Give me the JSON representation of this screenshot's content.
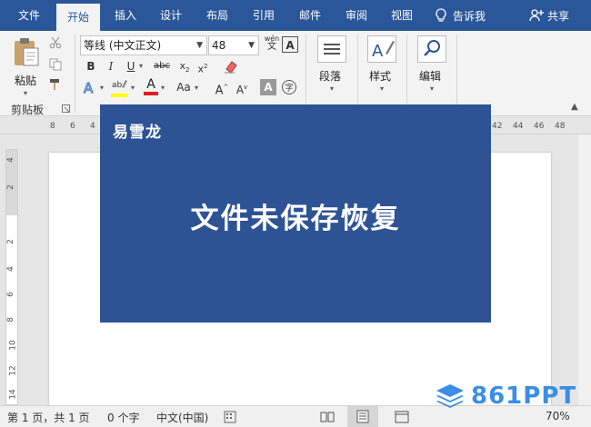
{
  "tabs": [
    {
      "label": "文件",
      "active": false
    },
    {
      "label": "开始",
      "active": true
    },
    {
      "label": "插入",
      "active": false
    },
    {
      "label": "设计",
      "active": false
    },
    {
      "label": "布局",
      "active": false
    },
    {
      "label": "引用",
      "active": false
    },
    {
      "label": "邮件",
      "active": false
    },
    {
      "label": "审阅",
      "active": false
    },
    {
      "label": "视图",
      "active": false
    }
  ],
  "tell_me": "告诉我",
  "share": "共享",
  "clipboard": {
    "paste_label": "粘贴",
    "group_label": "剪贴板"
  },
  "font": {
    "name": "等线 (中文正文)",
    "size": "48",
    "phonetic_glyph": "wén"
  },
  "paragraph": {
    "label": "段落"
  },
  "styles": {
    "label": "样式"
  },
  "editing": {
    "label": "编辑"
  },
  "ruler": {
    "h_left": [
      "8",
      "6",
      "4"
    ],
    "h_right": [
      "42",
      "44",
      "46",
      "48"
    ],
    "v": [
      "4",
      "2",
      "2",
      "4",
      "6",
      "8",
      "10",
      "12",
      "14"
    ]
  },
  "banner": {
    "brand": "易雪龙",
    "headline": "文件未保存恢复"
  },
  "status": {
    "page": "第 1 页，共 1 页",
    "words": "0 个字",
    "language": "中文(中国)",
    "zoom": "70%"
  },
  "watermark": "861PPT",
  "colors": {
    "brand_blue": "#2b579a",
    "banner_blue": "#2e5395",
    "watermark_blue": "#3a8ee6"
  }
}
